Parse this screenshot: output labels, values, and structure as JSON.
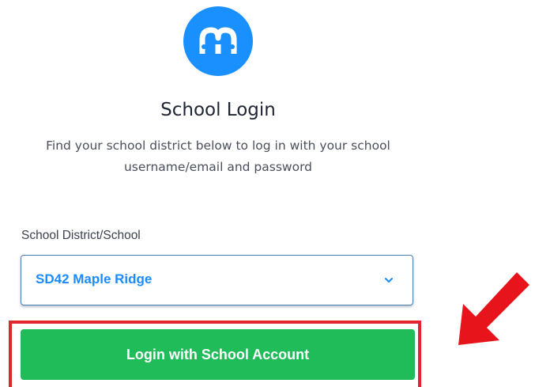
{
  "logo": {
    "icon": "brand-logo-icon",
    "color": "#1a90ff"
  },
  "title": "School Login",
  "subtitle_line1": "Find your school district below to log in with your school",
  "subtitle_line2": "username/email and password",
  "district_field": {
    "label": "School District/School",
    "selected_value": "SD42 Maple Ridge",
    "value_color": "#1a8cff",
    "icon": "chevron-down-icon"
  },
  "login_button": {
    "label": "Login with School Account",
    "color": "#21bc5a"
  },
  "annotation": {
    "color": "#e0262e",
    "icon": "red-arrow-icon"
  }
}
